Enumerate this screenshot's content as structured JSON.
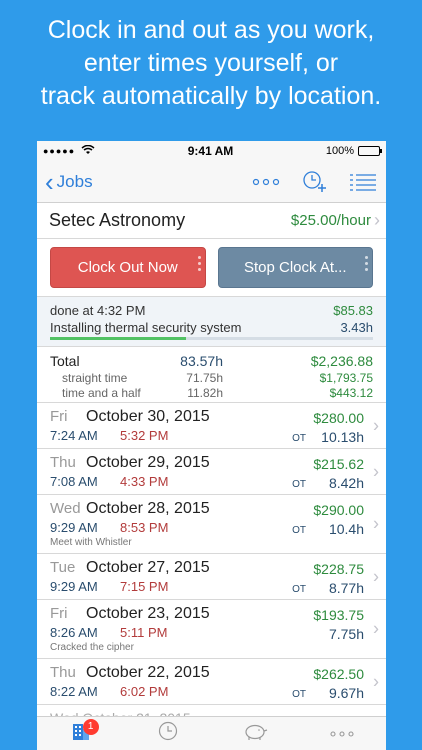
{
  "headline": {
    "line1": "Clock in and out as you work,",
    "line2": "enter times yourself, or",
    "line3": "track automatically by location."
  },
  "status_bar": {
    "carrier_dots": "●●●●●",
    "time": "9:41 AM",
    "battery": "100%"
  },
  "nav": {
    "back_label": "Jobs",
    "more_icon": "ellipsis-icon",
    "add_clock_icon": "clock-plus-icon",
    "list_icon": "list-icon"
  },
  "job": {
    "name": "Setec Astronomy",
    "rate": "$25.00/hour"
  },
  "buttons": {
    "clock_out": "Clock Out Now",
    "stop_clock": "Stop Clock At..."
  },
  "current": {
    "done_text": "done at 4:32 PM",
    "amount": "$85.83",
    "task": "Installing thermal security system",
    "hours": "3.43h",
    "progress_fraction": 0.42
  },
  "totals": {
    "label": "Total",
    "hours": "83.57h",
    "amount": "$2,236.88",
    "straight_label": "straight time",
    "straight_hours": "71.75h",
    "straight_amount": "$1,793.75",
    "half_label": "time and a half",
    "half_hours": "11.82h",
    "half_amount": "$443.12"
  },
  "entries": [
    {
      "dow": "Fri",
      "date": "October 30, 2015",
      "in": "7:24 AM",
      "out": "5:32 PM",
      "ot": "OT",
      "amount": "$280.00",
      "hours": "10.13h",
      "note": ""
    },
    {
      "dow": "Thu",
      "date": "October 29, 2015",
      "in": "7:08 AM",
      "out": "4:33 PM",
      "ot": "OT",
      "amount": "$215.62",
      "hours": "8.42h",
      "note": ""
    },
    {
      "dow": "Wed",
      "date": "October 28, 2015",
      "in": "9:29 AM",
      "out": "8:53 PM",
      "ot": "OT",
      "amount": "$290.00",
      "hours": "10.4h",
      "note": "Meet with Whistler"
    },
    {
      "dow": "Tue",
      "date": "October 27, 2015",
      "in": "9:29 AM",
      "out": "7:15 PM",
      "ot": "OT",
      "amount": "$228.75",
      "hours": "8.77h",
      "note": ""
    },
    {
      "dow": "Fri",
      "date": "October 23, 2015",
      "in": "8:26 AM",
      "out": "5:11 PM",
      "ot": "",
      "amount": "$193.75",
      "hours": "7.75h",
      "note": "Cracked the cipher"
    },
    {
      "dow": "Thu",
      "date": "October 22, 2015",
      "in": "8:22 AM",
      "out": "6:02 PM",
      "ot": "OT",
      "amount": "$262.50",
      "hours": "9.67h",
      "note": ""
    }
  ],
  "tabbar": {
    "badge": "1",
    "tabs": [
      "building-icon",
      "clock-icon",
      "piggy-bank-icon",
      "ellipsis-icon"
    ]
  },
  "colors": {
    "background": "#2f9bea",
    "accent": "#2f7fd9",
    "money_green": "#2e8b3e",
    "clock_out_red": "#de5552",
    "stop_gray": "#6d8aa3"
  }
}
